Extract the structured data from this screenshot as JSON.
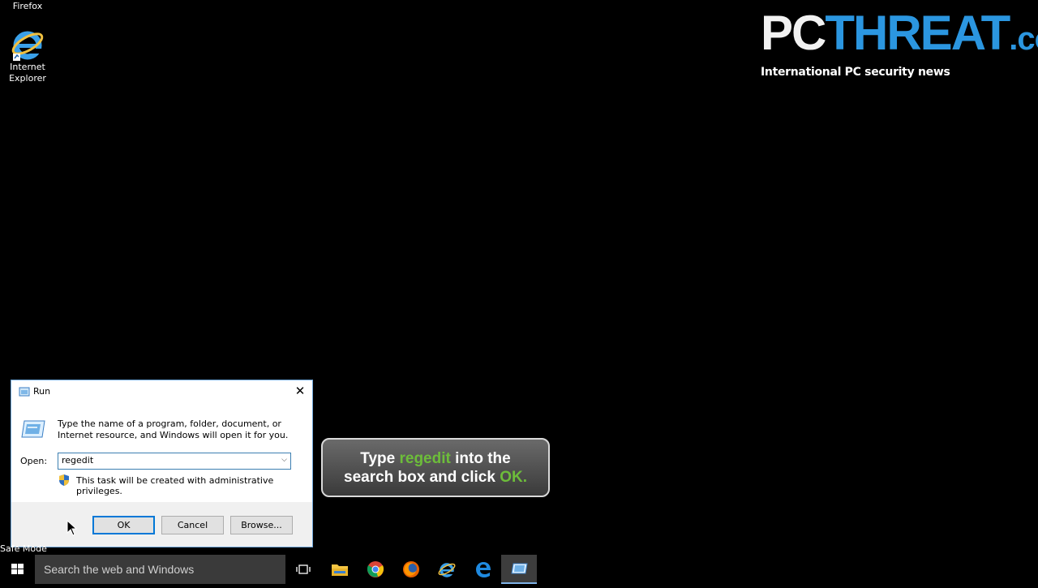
{
  "desktop": {
    "icons": [
      {
        "label": "Firefox"
      },
      {
        "label_line1": "Internet",
        "label_line2": "Explorer"
      }
    ]
  },
  "logo": {
    "part1": "PC",
    "part2": "THREAT",
    "part3": ".com",
    "tagline": "International PC security news"
  },
  "run_dialog": {
    "title": "Run",
    "description": "Type the name of a program, folder, document, or Internet resource, and Windows will open it for you.",
    "open_label": "Open:",
    "input_value": "regedit",
    "admin_note": "This task will be created with administrative privileges.",
    "buttons": {
      "ok": "OK",
      "cancel": "Cancel",
      "browse": "Browse..."
    }
  },
  "callout": {
    "t1": "Type ",
    "t2": "regedit",
    "t3": " into the",
    "t4": "search box and click ",
    "t5": "OK."
  },
  "safe_mode": "Safe Mode",
  "taskbar": {
    "search_placeholder": "Search the web and Windows",
    "apps": [
      "task-view-icon",
      "file-explorer-icon",
      "chrome-icon",
      "firefox-icon",
      "internet-explorer-icon",
      "edge-icon",
      "run-icon"
    ]
  },
  "colors": {
    "accent": "#2b96e0",
    "highlight": "#6dbd3a",
    "focus": "#0078d7"
  }
}
